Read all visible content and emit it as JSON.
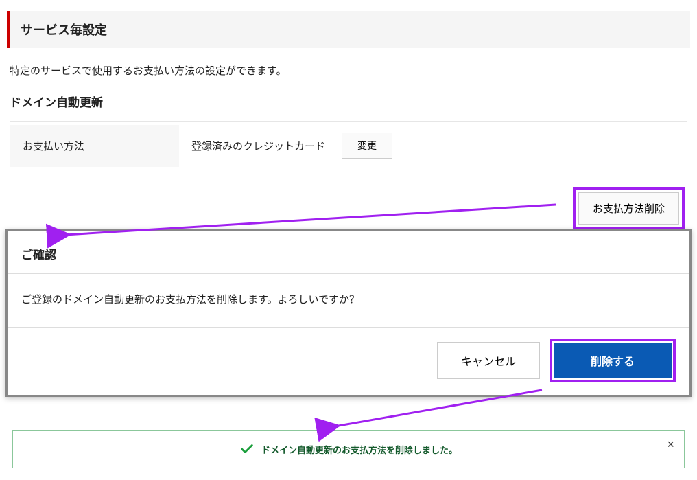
{
  "section": {
    "title": "サービス毎設定",
    "description": "特定のサービスで使用するお支払い方法の設定ができます。",
    "sub_heading": "ドメイン自動更新"
  },
  "settings_row": {
    "label": "お支払い方法",
    "value": "登録済みのクレジットカード",
    "change_button": "変更"
  },
  "delete_button": {
    "label": "お支払方法削除"
  },
  "confirm_dialog": {
    "title": "ご確認",
    "message": "ご登録のドメイン自動更新のお支払方法を削除します。よろしいですか？",
    "cancel_label": "キャンセル",
    "confirm_label": "削除する"
  },
  "success_toast": {
    "message": "ドメイン自動更新のお支払方法を削除しました。",
    "close_label": "×"
  },
  "annotation": {
    "highlight_color": "#a020f0"
  }
}
